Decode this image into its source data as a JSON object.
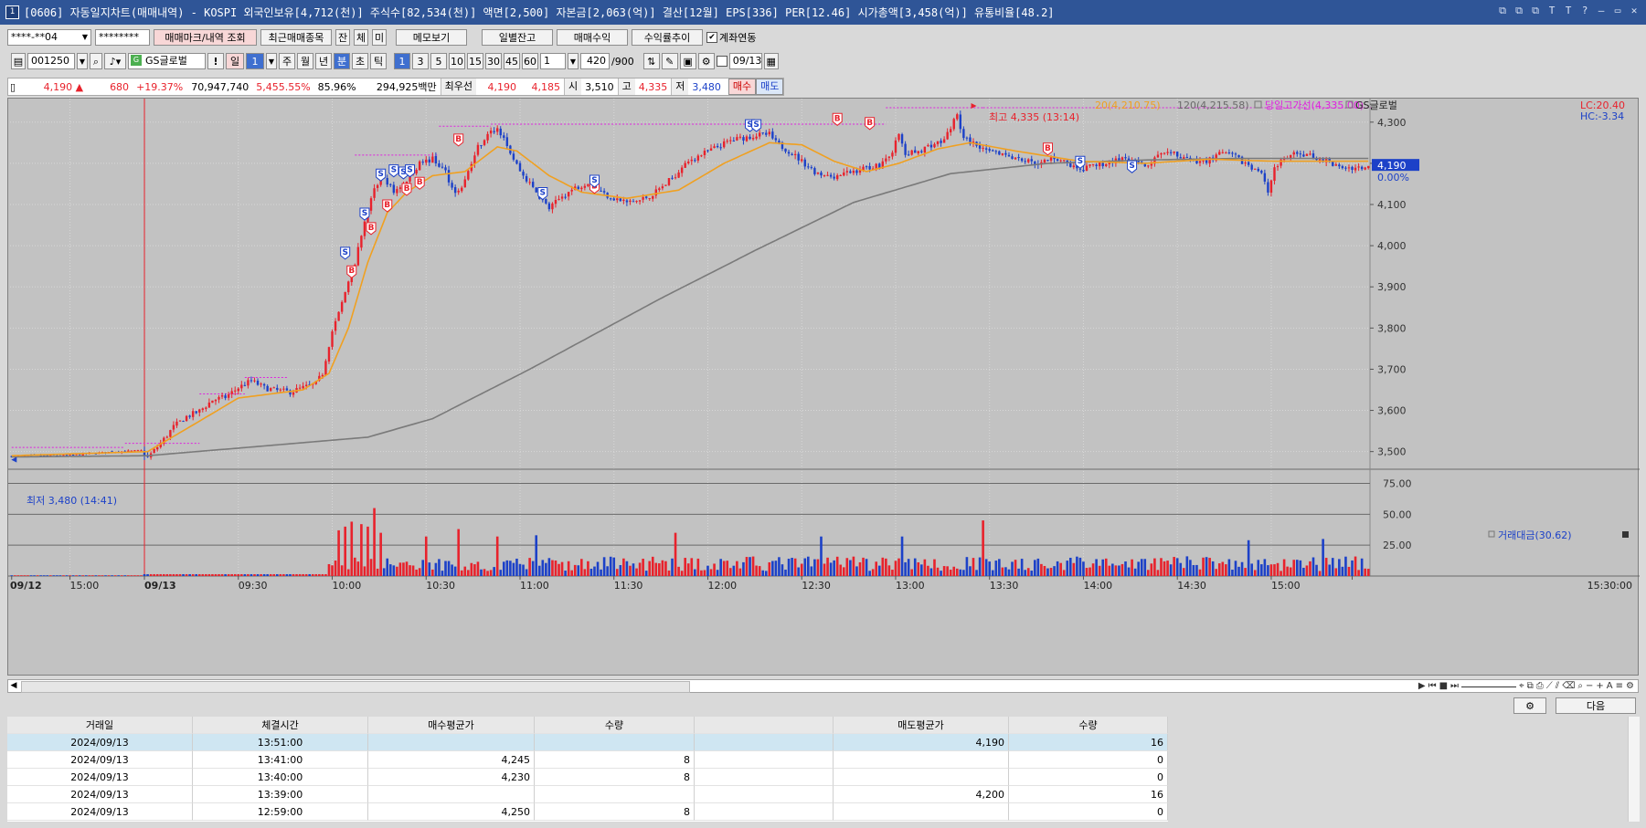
{
  "window": {
    "title": "[0606] 자동일지차트(매매내역) - KOSPI 외국인보유[4,712(천)] 주식수[82,534(천)] 액면[2,500] 자본금[2,063(억)] 결산[12월] EPS[336] PER[12.46] 시가총액[3,458(억)] 유통비율[48.2]",
    "app_icon": "1",
    "controls": [
      "⧉",
      "⧉",
      "⧉",
      "T",
      "T",
      "?",
      "—",
      "▭",
      "✕"
    ]
  },
  "toolbar1": {
    "account": "****-**04",
    "password": "********",
    "btn_markers": "매매마크/내역 조회",
    "btn_recent": "최근매매종목",
    "btn_jan": "잔",
    "btn_che": "체",
    "btn_mi": "미",
    "btn_memo": "메모보기",
    "btn_daily": "일별잔고",
    "btn_profit": "매매수익",
    "btn_return": "수익률추이",
    "link_label": "계좌연동",
    "link_checked": "✔"
  },
  "toolbar2": {
    "code": "001250",
    "name": "GS글로벌",
    "exclaim": "!",
    "btn_day": "일",
    "day_n": "1",
    "btn_week": "주",
    "btn_month": "월",
    "btn_year": "년",
    "btn_min": "분",
    "btn_sec": "초",
    "btn_tick": "틱",
    "intervals": [
      "1",
      "3",
      "5",
      "10",
      "15",
      "30",
      "45",
      "60"
    ],
    "count": "1",
    "bars": "420",
    "bars_max": "/900",
    "date": "09/13"
  },
  "quote": {
    "price": "4,190 ▲",
    "change": "680",
    "change_pct": "+19.37%",
    "volume": "70,947,740",
    "vol_ratio": "5,455.55%",
    "turnover": "85.96%",
    "amount": "294,925백만",
    "bid_label": "최우선",
    "bid1": "4,190",
    "bid2": "4,185",
    "open_label": "시",
    "open": "3,510",
    "high_label": "고",
    "high": "4,335",
    "low_label": "저",
    "low": "3,480",
    "buy_btn": "매수",
    "sell_btn": "매도"
  },
  "colors": {
    "up": "#e8222c",
    "down": "#1c41c8",
    "ma20": "#f0a020",
    "ma120": "#7a7a7a",
    "high_line": "#e020e0",
    "chart_bg": "#c2c2c2"
  },
  "chart_data": {
    "type": "candlestick+volume",
    "title": "",
    "legend": {
      "ma20": "20(4,210.75)",
      "ma120": "120(4,215.58)",
      "high_line": "당일고가선(4,335.00)",
      "symbol": "GS글로벌"
    },
    "lc": "LC:20.40",
    "hc": "HC:-3.34",
    "current_price": "4,190",
    "current_pct": "0.00%",
    "high_annotation": "최고 4,335 (13:14)",
    "low_annotation": "최저 3,480 (14:41)",
    "y_ticks": [
      "4,300",
      "4,200",
      "4,100",
      "4,000",
      "3,900",
      "3,800",
      "3,700",
      "3,600",
      "3,500"
    ],
    "y_tick_values": [
      4300,
      4200,
      4100,
      4000,
      3900,
      3800,
      3700,
      3600,
      3500
    ],
    "ylim": [
      3466,
      4335
    ],
    "volume_label": "거래대금(30.62)",
    "volume_ticks": [
      "75.00",
      "50.00",
      "25.00"
    ],
    "volume_tick_values": [
      75,
      50,
      25
    ],
    "volume_ylim": [
      0,
      82
    ],
    "x_ticks": [
      "09/12",
      "15:00",
      "09/13",
      "09:30",
      "10:00",
      "10:30",
      "11:00",
      "11:30",
      "12:00",
      "12:30",
      "13:00",
      "13:30",
      "14:00",
      "14:30",
      "15:00",
      "15:30:00"
    ],
    "anchors": [
      [
        0,
        3488
      ],
      [
        8,
        3491
      ],
      [
        16,
        3490
      ],
      [
        24,
        3495
      ],
      [
        32,
        3500
      ],
      [
        40,
        3502
      ],
      [
        42,
        3485
      ],
      [
        46,
        3520
      ],
      [
        50,
        3560
      ],
      [
        54,
        3585
      ],
      [
        58,
        3598
      ],
      [
        62,
        3625
      ],
      [
        66,
        3632
      ],
      [
        70,
        3655
      ],
      [
        74,
        3672
      ],
      [
        78,
        3655
      ],
      [
        82,
        3648
      ],
      [
        86,
        3645
      ],
      [
        90,
        3655
      ],
      [
        94,
        3665
      ],
      [
        96,
        3690
      ],
      [
        98,
        3760
      ],
      [
        100,
        3815
      ],
      [
        102,
        3860
      ],
      [
        104,
        3915
      ],
      [
        106,
        3960
      ],
      [
        108,
        4025
      ],
      [
        110,
        4085
      ],
      [
        112,
        4135
      ],
      [
        114,
        4165
      ],
      [
        116,
        4155
      ],
      [
        118,
        4130
      ],
      [
        122,
        4160
      ],
      [
        126,
        4200
      ],
      [
        130,
        4210
      ],
      [
        134,
        4180
      ],
      [
        136,
        4140
      ],
      [
        138,
        4130
      ],
      [
        140,
        4160
      ],
      [
        142,
        4200
      ],
      [
        144,
        4240
      ],
      [
        146,
        4260
      ],
      [
        148,
        4275
      ],
      [
        150,
        4285
      ],
      [
        152,
        4265
      ],
      [
        155,
        4210
      ],
      [
        158,
        4170
      ],
      [
        162,
        4130
      ],
      [
        166,
        4090
      ],
      [
        170,
        4120
      ],
      [
        174,
        4140
      ],
      [
        178,
        4155
      ],
      [
        182,
        4130
      ],
      [
        186,
        4115
      ],
      [
        190,
        4105
      ],
      [
        194,
        4110
      ],
      [
        198,
        4125
      ],
      [
        202,
        4150
      ],
      [
        206,
        4180
      ],
      [
        210,
        4210
      ],
      [
        214,
        4225
      ],
      [
        218,
        4240
      ],
      [
        222,
        4255
      ],
      [
        226,
        4262
      ],
      [
        230,
        4268
      ],
      [
        234,
        4270
      ],
      [
        236,
        4250
      ],
      [
        240,
        4230
      ],
      [
        244,
        4205
      ],
      [
        248,
        4180
      ],
      [
        252,
        4168
      ],
      [
        256,
        4172
      ],
      [
        260,
        4180
      ],
      [
        264,
        4190
      ],
      [
        268,
        4195
      ],
      [
        272,
        4230
      ],
      [
        274,
        4270
      ],
      [
        276,
        4220
      ],
      [
        280,
        4230
      ],
      [
        284,
        4245
      ],
      [
        288,
        4255
      ],
      [
        290,
        4290
      ],
      [
        292,
        4315
      ],
      [
        294,
        4260
      ],
      [
        298,
        4245
      ],
      [
        302,
        4235
      ],
      [
        306,
        4225
      ],
      [
        310,
        4215
      ],
      [
        314,
        4205
      ],
      [
        318,
        4200
      ],
      [
        322,
        4215
      ],
      [
        326,
        4200
      ],
      [
        330,
        4180
      ],
      [
        334,
        4195
      ],
      [
        338,
        4200
      ],
      [
        342,
        4210
      ],
      [
        346,
        4205
      ],
      [
        350,
        4190
      ],
      [
        354,
        4215
      ],
      [
        358,
        4225
      ],
      [
        362,
        4215
      ],
      [
        366,
        4200
      ],
      [
        370,
        4210
      ],
      [
        374,
        4225
      ],
      [
        378,
        4215
      ],
      [
        382,
        4195
      ],
      [
        386,
        4180
      ],
      [
        388,
        4130
      ],
      [
        390,
        4190
      ],
      [
        394,
        4215
      ],
      [
        398,
        4225
      ],
      [
        402,
        4215
      ],
      [
        406,
        4205
      ],
      [
        410,
        4190
      ]
    ],
    "ma120_anchors": [
      [
        0,
        3487
      ],
      [
        42,
        3490
      ],
      [
        80,
        3515
      ],
      [
        110,
        3535
      ],
      [
        130,
        3580
      ],
      [
        160,
        3700
      ],
      [
        200,
        3870
      ],
      [
        230,
        3990
      ],
      [
        260,
        4105
      ],
      [
        290,
        4175
      ],
      [
        320,
        4200
      ],
      [
        350,
        4208
      ],
      [
        380,
        4212
      ],
      [
        410,
        4212
      ]
    ],
    "ma20_anchors": [
      [
        0,
        3490
      ],
      [
        42,
        3500
      ],
      [
        55,
        3560
      ],
      [
        70,
        3630
      ],
      [
        90,
        3650
      ],
      [
        98,
        3690
      ],
      [
        104,
        3800
      ],
      [
        110,
        3960
      ],
      [
        116,
        4080
      ],
      [
        122,
        4130
      ],
      [
        130,
        4170
      ],
      [
        140,
        4180
      ],
      [
        150,
        4240
      ],
      [
        156,
        4230
      ],
      [
        166,
        4170
      ],
      [
        176,
        4130
      ],
      [
        190,
        4115
      ],
      [
        206,
        4135
      ],
      [
        220,
        4200
      ],
      [
        234,
        4250
      ],
      [
        244,
        4245
      ],
      [
        254,
        4205
      ],
      [
        264,
        4180
      ],
      [
        274,
        4200
      ],
      [
        286,
        4235
      ],
      [
        296,
        4250
      ],
      [
        310,
        4230
      ],
      [
        330,
        4205
      ],
      [
        350,
        4200
      ],
      [
        370,
        4210
      ],
      [
        390,
        4205
      ],
      [
        410,
        4205
      ]
    ],
    "day_break_index": 41,
    "high_line_segments": [
      [
        0,
        35,
        3510
      ],
      [
        35,
        58,
        3520
      ],
      [
        58,
        72,
        3640
      ],
      [
        72,
        85,
        3680
      ],
      [
        106,
        132,
        4220
      ],
      [
        132,
        148,
        4290
      ],
      [
        148,
        270,
        4295
      ],
      [
        270,
        300,
        4335
      ],
      [
        300,
        420,
        4335
      ]
    ],
    "buy_markers": [
      [
        105,
        3920
      ],
      [
        111,
        4025
      ],
      [
        116,
        4080
      ],
      [
        122,
        4120
      ],
      [
        126,
        4135
      ],
      [
        138,
        4240
      ],
      [
        180,
        4125
      ],
      [
        255,
        4290
      ],
      [
        265,
        4280
      ],
      [
        320,
        4218
      ]
    ],
    "sell_markers": [
      [
        103,
        3965
      ],
      [
        109,
        4060
      ],
      [
        114,
        4155
      ],
      [
        118,
        4165
      ],
      [
        121,
        4160
      ],
      [
        123,
        4165
      ],
      [
        164,
        4110
      ],
      [
        180,
        4140
      ],
      [
        228,
        4275
      ],
      [
        230,
        4275
      ],
      [
        330,
        4186
      ],
      [
        346,
        4175
      ]
    ],
    "volume_spikes": [
      [
        101,
        37
      ],
      [
        103,
        40
      ],
      [
        105,
        44
      ],
      [
        108,
        42
      ],
      [
        110,
        40
      ],
      [
        112,
        55
      ],
      [
        114,
        35
      ],
      [
        128,
        32
      ],
      [
        138,
        38
      ],
      [
        150,
        32
      ],
      [
        162,
        33
      ],
      [
        205,
        35
      ],
      [
        250,
        32
      ],
      [
        275,
        32
      ],
      [
        300,
        45
      ],
      [
        382,
        29
      ],
      [
        405,
        30
      ]
    ]
  },
  "table": {
    "columns": [
      "거래일",
      "체결시간",
      "매수평균가",
      "수량",
      "",
      "매도평균가",
      "수량"
    ],
    "rows": [
      [
        "2024/09/13",
        "13:51:00",
        "",
        "",
        "",
        "4,190",
        "16"
      ],
      [
        "2024/09/13",
        "13:41:00",
        "4,245",
        "8",
        "",
        "",
        "0"
      ],
      [
        "2024/09/13",
        "13:40:00",
        "4,230",
        "8",
        "",
        "",
        "0"
      ],
      [
        "2024/09/13",
        "13:39:00",
        "",
        "",
        "",
        "4,200",
        "16"
      ],
      [
        "2024/09/13",
        "12:59:00",
        "4,250",
        "8",
        "",
        "",
        "0"
      ]
    ]
  },
  "footer": {
    "next_btn": "다음",
    "settings_icon": "settings-icon"
  }
}
